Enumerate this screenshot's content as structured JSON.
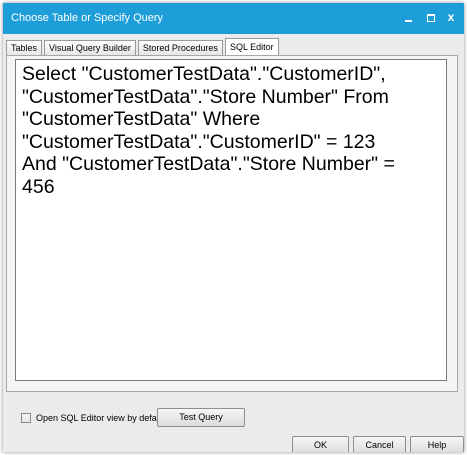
{
  "window": {
    "title": "Choose Table or Specify Query",
    "accent_color": "#1e9ed9",
    "controls": {
      "minimize_icon": "minimize-icon",
      "maximize_icon": "maximize-icon",
      "close_label": "x"
    }
  },
  "tabs": [
    {
      "label": "Tables",
      "active": false
    },
    {
      "label": "Visual Query Builder",
      "active": false
    },
    {
      "label": "Stored Procedures",
      "active": false
    },
    {
      "label": "SQL Editor",
      "active": true
    }
  ],
  "editor": {
    "text": "Select \"CustomerTestData\".\"CustomerID\",\n\"CustomerTestData\".\"Store Number\" From\n\"CustomerTestData\" Where\n\"CustomerTestData\".\"CustomerID\" = 123\nAnd \"CustomerTestData\".\"Store Number\" =\n456"
  },
  "footer": {
    "checkbox_label": "Open SQL Editor view by default",
    "checkbox_checked": false,
    "test_query_label": "Test Query",
    "ok_label": "OK",
    "cancel_label": "Cancel",
    "help_label": "Help"
  }
}
